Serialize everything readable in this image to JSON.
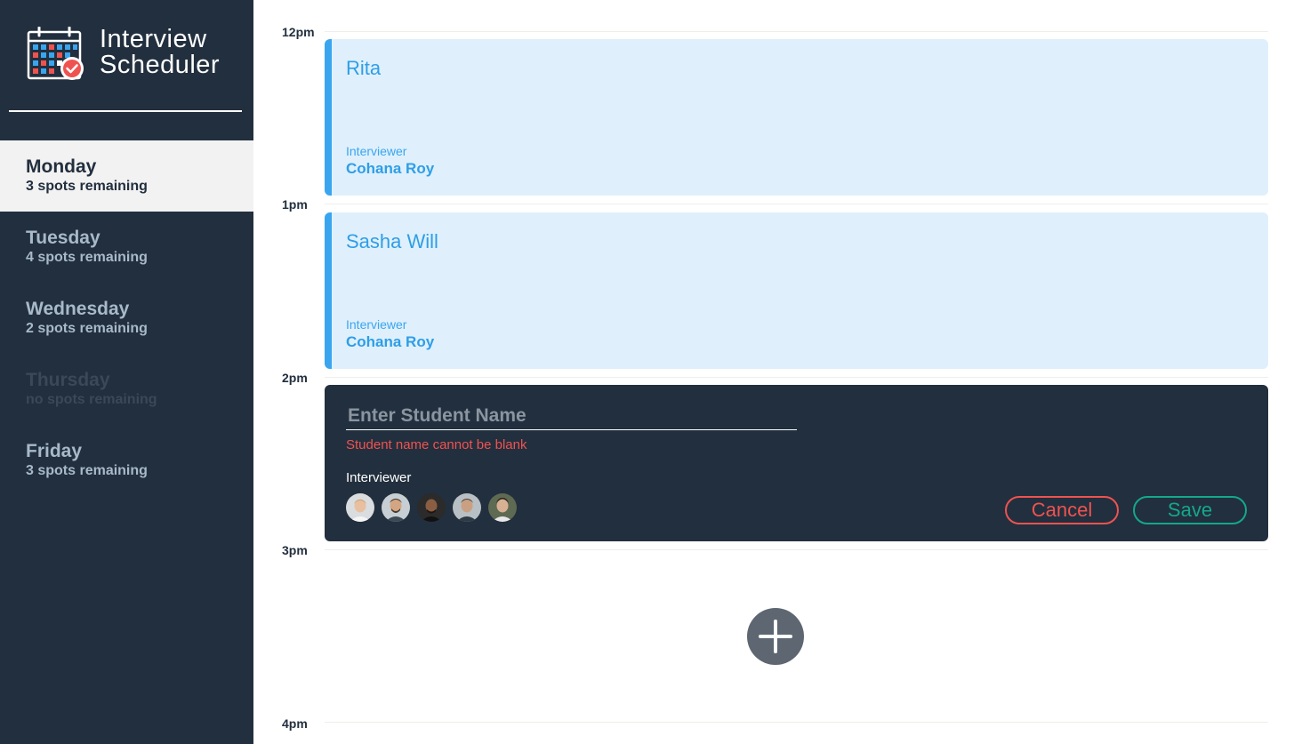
{
  "brand": {
    "line1": "Interview",
    "line2": "Scheduler",
    "logo_icon": "calendar-check-icon"
  },
  "days": [
    {
      "name": "Monday",
      "spots": "3 spots remaining",
      "state": "selected"
    },
    {
      "name": "Tuesday",
      "spots": "4 spots remaining",
      "state": "available"
    },
    {
      "name": "Wednesday",
      "spots": "2 spots remaining",
      "state": "available"
    },
    {
      "name": "Thursday",
      "spots": "no spots remaining",
      "state": "full"
    },
    {
      "name": "Friday",
      "spots": "3 spots remaining",
      "state": "available"
    }
  ],
  "times": [
    "12pm",
    "1pm",
    "2pm",
    "3pm",
    "4pm"
  ],
  "appointments": [
    {
      "student": "Rita",
      "interviewer_label": "Interviewer",
      "interviewer": "Cohana Roy"
    },
    {
      "student": "Sasha Will",
      "interviewer_label": "Interviewer",
      "interviewer": "Cohana Roy"
    }
  ],
  "form": {
    "name_placeholder": "Enter Student Name",
    "name_value": "",
    "validation_error": "Student name cannot be blank",
    "interviewer_label": "Interviewer",
    "cancel_label": "Cancel",
    "save_label": "Save"
  },
  "add_button_icon": "plus-icon",
  "colors": {
    "sidebar_bg": "#222f3e",
    "appointment_bg": "#dff0fc",
    "appointment_accent": "#3aa5ef",
    "danger": "#ef5350",
    "success": "#14a889"
  }
}
